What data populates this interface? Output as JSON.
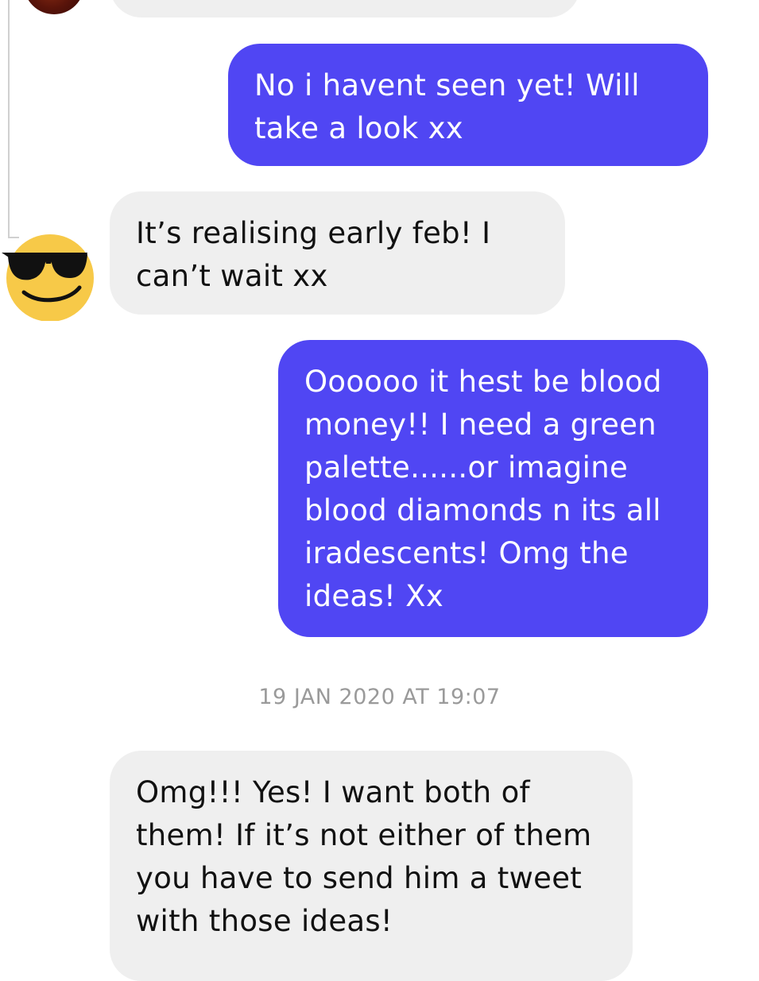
{
  "conversation": {
    "messages": [
      {
        "side": "outgoing",
        "text": "No i havent seen yet! Will take a look xx"
      },
      {
        "side": "incoming",
        "text": "It’s realising early feb! I can’t wait xx",
        "avatar": "sunglasses-emoji-icon"
      },
      {
        "side": "outgoing",
        "text": "Oooooo it hest be blood money!! I need a green palette......or imagine blood diamonds n its all iradescents! Omg the ideas! Xx"
      },
      {
        "side": "incoming",
        "text": "Omg!!! Yes! I want both of them! If it’s not either of them you have to send him a tweet with those ideas!"
      }
    ],
    "timestamp": "19 JAN 2020 AT 19:07"
  },
  "colors": {
    "outgoing_bubble": "#5046f3",
    "incoming_bubble": "#efefef",
    "timestamp_text": "#9a9a9a"
  }
}
